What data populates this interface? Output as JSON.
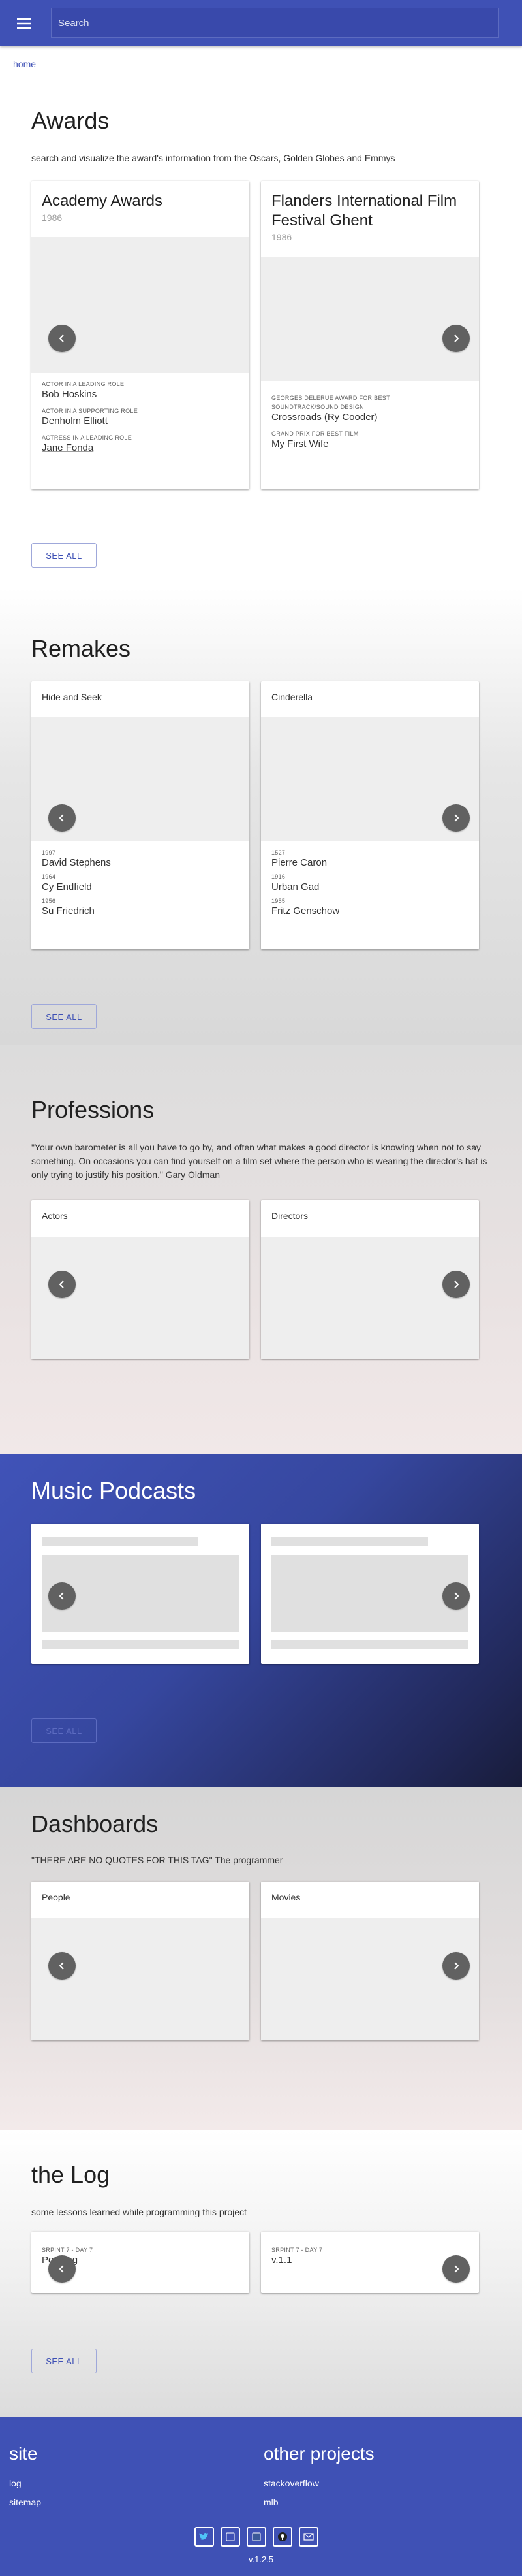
{
  "search": {
    "placeholder": "Search"
  },
  "breadcrumb": {
    "home": "home"
  },
  "awards": {
    "title": "Awards",
    "subtitle": "search and visualize the award's information from the Oscars, Golden Globes and Emmys",
    "see_all": "SEE ALL",
    "cards": [
      {
        "title": "Academy Awards",
        "year": "1986",
        "items": [
          {
            "category": "ACTOR IN A LEADING ROLE",
            "value": "Bob Hoskins"
          },
          {
            "category": "ACTOR IN A SUPPORTING ROLE",
            "value": "Denholm Elliott"
          },
          {
            "category": "ACTRESS IN A LEADING ROLE",
            "value": "Jane Fonda"
          }
        ]
      },
      {
        "title": "Flanders International Film Festival Ghent",
        "year": "1986",
        "items": [
          {
            "category": "GEORGES DELERUE AWARD FOR BEST",
            "value": ""
          },
          {
            "category": "SOUNDTRACK/SOUND DESIGN",
            "value": "Crossroads (Ry Cooder)"
          },
          {
            "category": "GRAND PRIX FOR BEST FILM",
            "value": "My First Wife"
          }
        ]
      }
    ]
  },
  "remakes": {
    "title": "Remakes",
    "see_all": "SEE ALL",
    "cards": [
      {
        "title": "Hide and Seek",
        "items": [
          {
            "year": "1997",
            "value": "David Stephens"
          },
          {
            "year": "1964",
            "value": "Cy Endfield"
          },
          {
            "year": "1956",
            "value": "Su Friedrich"
          }
        ]
      },
      {
        "title": "Cinderella",
        "items": [
          {
            "year": "1527",
            "value": "Pierre Caron"
          },
          {
            "year": "1916",
            "value": "Urban Gad"
          },
          {
            "year": "1955",
            "value": "Fritz Genschow"
          }
        ]
      }
    ]
  },
  "professions": {
    "title": "Professions",
    "quote": "\"Your own barometer is all you have to go by, and often what makes a good director is knowing when not to say something. On occasions you can find yourself on a film set where the person who is wearing the director's hat is only trying to justify his position.\" Gary Oldman",
    "cards": [
      {
        "title": "Actors"
      },
      {
        "title": "Directors"
      }
    ]
  },
  "music": {
    "title": "Music Podcasts",
    "see_all": "SEE ALL"
  },
  "dashboards": {
    "title": "Dashboards",
    "quote": "\"THERE ARE NO QUOTES FOR THIS TAG\" The programmer",
    "cards": [
      {
        "title": "People"
      },
      {
        "title": "Movies"
      }
    ]
  },
  "log": {
    "title": "the Log",
    "subtitle": "some lessons learned while programming this project",
    "see_all": "SEE ALL",
    "cards": [
      {
        "caption": "SRPINT 7 - DAY 7",
        "value": "Pending"
      },
      {
        "caption": "SRPINT 7 - DAY 7",
        "value": "v.1.1"
      }
    ]
  },
  "footer": {
    "site_heading": "site",
    "site_links": [
      "log",
      "sitemap"
    ],
    "other_heading": "other projects",
    "other_links": [
      "stackoverflow",
      "mlb"
    ],
    "social": [
      "twitter-icon",
      "linkedin-icon",
      "facebook-icon",
      "github-icon",
      "email-icon"
    ],
    "version": "v.1.2.5"
  },
  "colors": {
    "primary": "#3f51b5",
    "nav_circle": "#616161",
    "media_bg": "#eeeeee"
  }
}
